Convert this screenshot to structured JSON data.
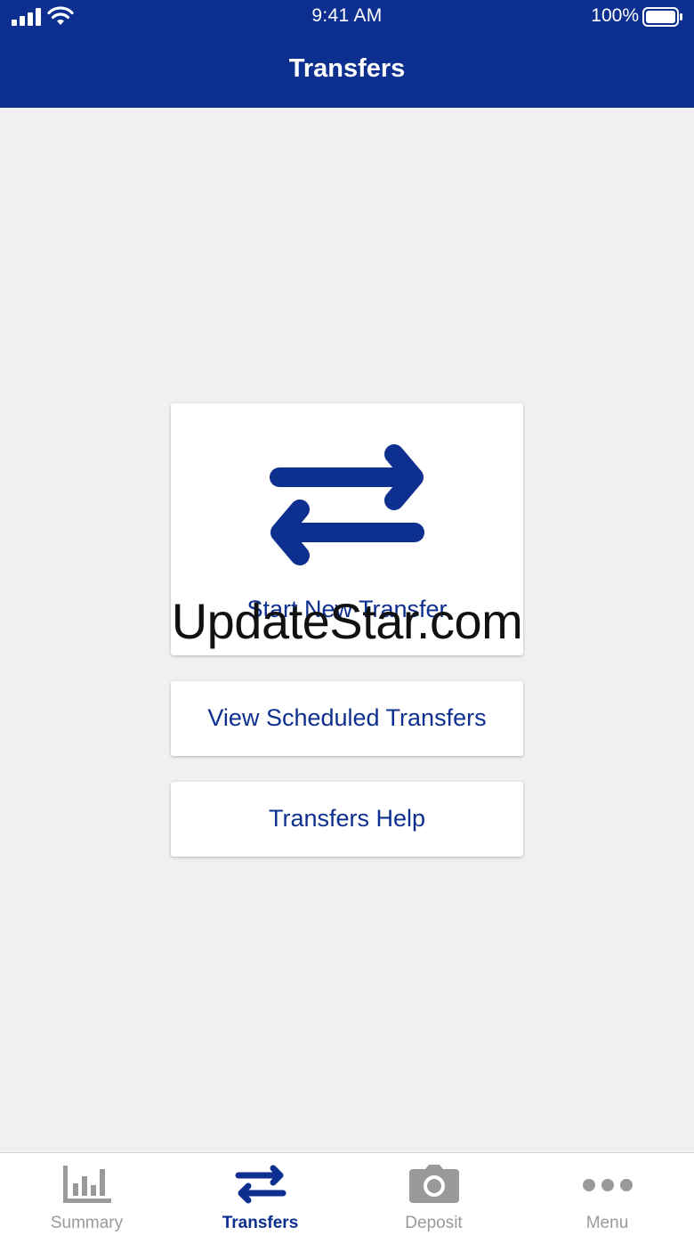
{
  "status_bar": {
    "time": "9:41 AM",
    "battery": "100%"
  },
  "header": {
    "title": "Transfers"
  },
  "actions": {
    "start_new": "Start New Transfer",
    "view_scheduled": "View Scheduled Transfers",
    "help": "Transfers Help"
  },
  "watermark": "UpdateStar.com",
  "tabs": [
    {
      "label": "Summary",
      "icon": "bar-chart-icon",
      "active": false
    },
    {
      "label": "Transfers",
      "icon": "swap-arrows-icon",
      "active": true
    },
    {
      "label": "Deposit",
      "icon": "camera-icon",
      "active": false
    },
    {
      "label": "Menu",
      "icon": "more-dots-icon",
      "active": false
    }
  ],
  "colors": {
    "brand": "#0d2f8f",
    "background": "#f0f0f0",
    "inactive_tab": "#9a9a9a"
  }
}
